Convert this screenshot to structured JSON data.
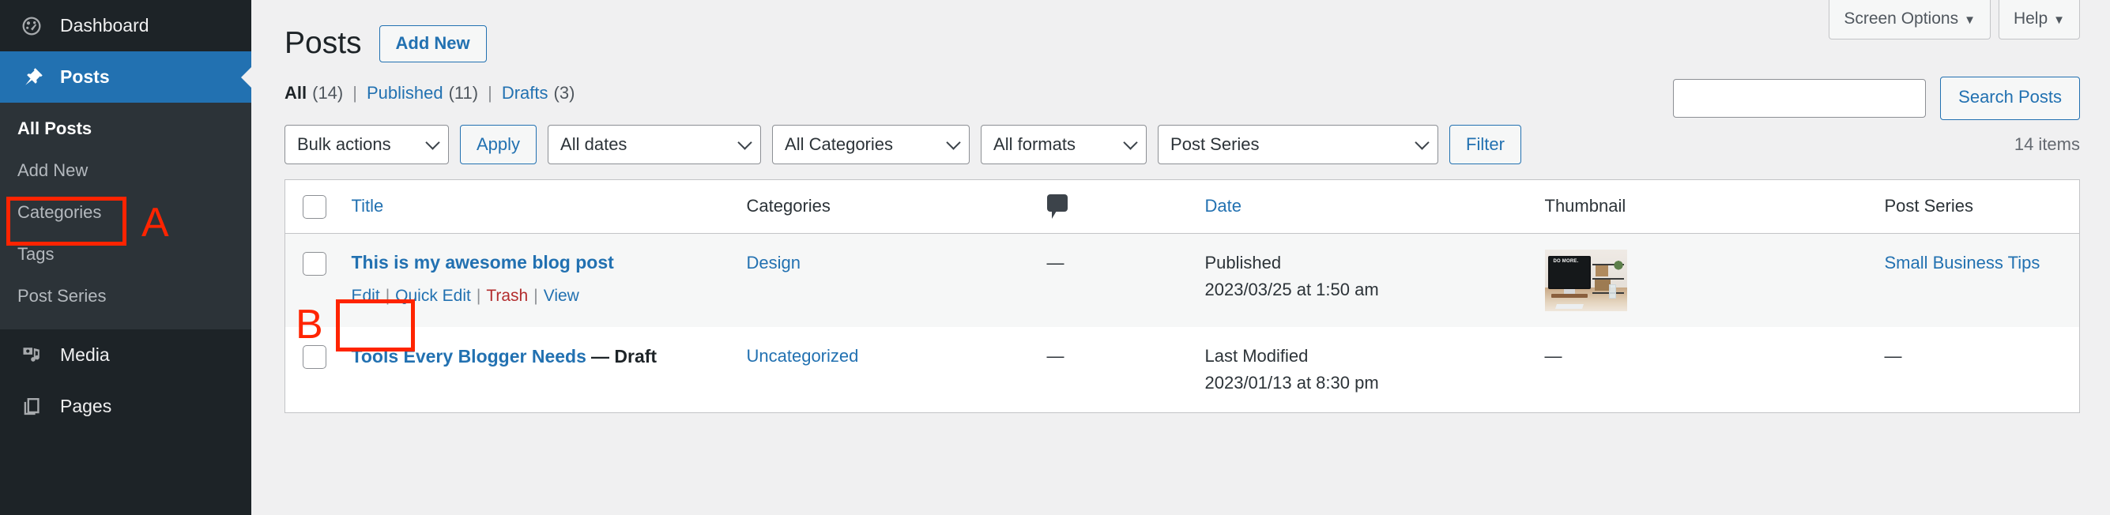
{
  "sidebar": {
    "items": [
      {
        "label": "Dashboard",
        "icon": "dashboard-icon",
        "current": false
      },
      {
        "label": "Posts",
        "icon": "pin-icon",
        "current": true
      },
      {
        "label": "Media",
        "icon": "media-icon",
        "current": false
      },
      {
        "label": "Pages",
        "icon": "pages-icon",
        "current": false
      }
    ],
    "submenu": [
      {
        "label": "All Posts",
        "current": true
      },
      {
        "label": "Add New",
        "current": false
      },
      {
        "label": "Categories",
        "current": false
      },
      {
        "label": "Tags",
        "current": false
      },
      {
        "label": "Post Series",
        "current": false
      }
    ]
  },
  "screen_meta": {
    "screen_options": "Screen Options",
    "help": "Help",
    "caret": "▼"
  },
  "header": {
    "title": "Posts",
    "add_new": "Add New"
  },
  "search": {
    "value": "",
    "placeholder": "",
    "submit": "Search Posts"
  },
  "views": {
    "all_label": "All",
    "all_count": "(14)",
    "published_label": "Published",
    "published_count": "(11)",
    "drafts_label": "Drafts",
    "drafts_count": "(3)",
    "divider": "|"
  },
  "tablenav": {
    "bulk_actions": "Bulk actions",
    "apply": "Apply",
    "all_dates": "All dates",
    "all_categories": "All Categories",
    "all_formats": "All formats",
    "post_series": "Post Series",
    "filter": "Filter",
    "displaying_num": "14 items"
  },
  "table": {
    "columns": {
      "title": "Title",
      "categories": "Categories",
      "comments": "comment-bubble-icon",
      "date": "Date",
      "thumbnail": "Thumbnail",
      "post_series": "Post Series"
    },
    "rows": [
      {
        "title": "This is my awesome blog post",
        "state": "",
        "actions": {
          "edit": "Edit",
          "quick_edit": "Quick Edit",
          "trash": "Trash",
          "view": "View",
          "separator": "|"
        },
        "categories": "Design",
        "comments": "—",
        "date_status": "Published",
        "date_value": "2023/03/25 at 1:50 am",
        "thumbnail": "desk-imac-photo",
        "thumbnail_text": "DO MORE.",
        "post_series": "Small Business Tips"
      },
      {
        "title": "Tools Every Blogger Needs",
        "state": "— Draft",
        "actions": null,
        "categories": "Uncategorized",
        "comments": "—",
        "date_status": "Last Modified",
        "date_value": "2023/01/13 at 8:30 pm",
        "thumbnail": "",
        "thumbnail_placeholder": "—",
        "post_series": "—"
      }
    ]
  },
  "annotations": [
    {
      "letter": "A",
      "target": "sidebar-add-new",
      "color": "#ff2400"
    },
    {
      "letter": "B",
      "target": "row-action-edit",
      "color": "#ff2400"
    }
  ]
}
